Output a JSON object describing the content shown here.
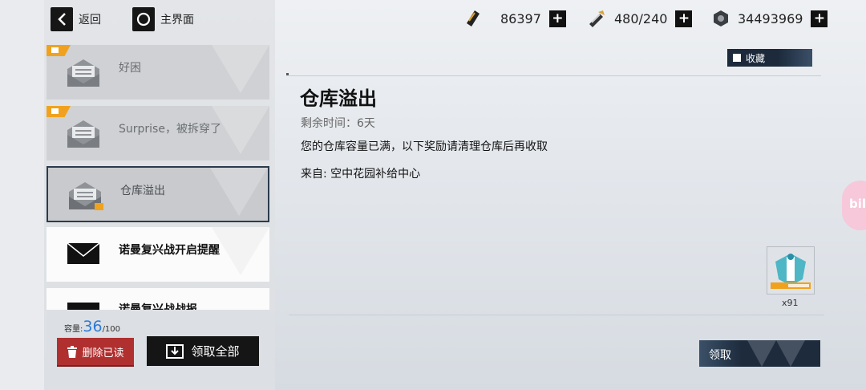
{
  "nav": {
    "back_label": "返回",
    "home_label": "主界面"
  },
  "resources": [
    {
      "icon": "ticket-icon",
      "value": "86397"
    },
    {
      "icon": "fuel-icon",
      "value": "480/240"
    },
    {
      "icon": "coin-icon",
      "value": "34493969"
    }
  ],
  "mail_list": [
    {
      "title": "好困",
      "state": "read"
    },
    {
      "title": "Surprise，被拆穿了",
      "state": "read"
    },
    {
      "title": "仓库溢出",
      "state": "selected"
    },
    {
      "title": "诺曼复兴战开启提醒",
      "state": "unread"
    },
    {
      "title": "诺曼复兴战战报",
      "state": "unread"
    }
  ],
  "capacity": {
    "label": "容量:",
    "current": "36",
    "max": "/100"
  },
  "buttons": {
    "delete_read": "删除已读",
    "claim_all": "领取全部",
    "favorite": "收藏",
    "claim": "领取"
  },
  "detail": {
    "title": "仓库溢出",
    "remaining_time": "剩余时间：6天",
    "body": "您的仓库容量已满，以下奖励请清理仓库后再收取",
    "from": "来自: 空中花园补给中心",
    "reward": {
      "icon": "reward-item-icon",
      "quantity": "x91"
    }
  },
  "floating": {
    "bili_label": "bili"
  },
  "colors": {
    "accent_blue": "#2c7bd6",
    "delete_red": "#b03030",
    "dark_navy": "#1d2b3d",
    "flag_orange": "#f0a21e"
  }
}
